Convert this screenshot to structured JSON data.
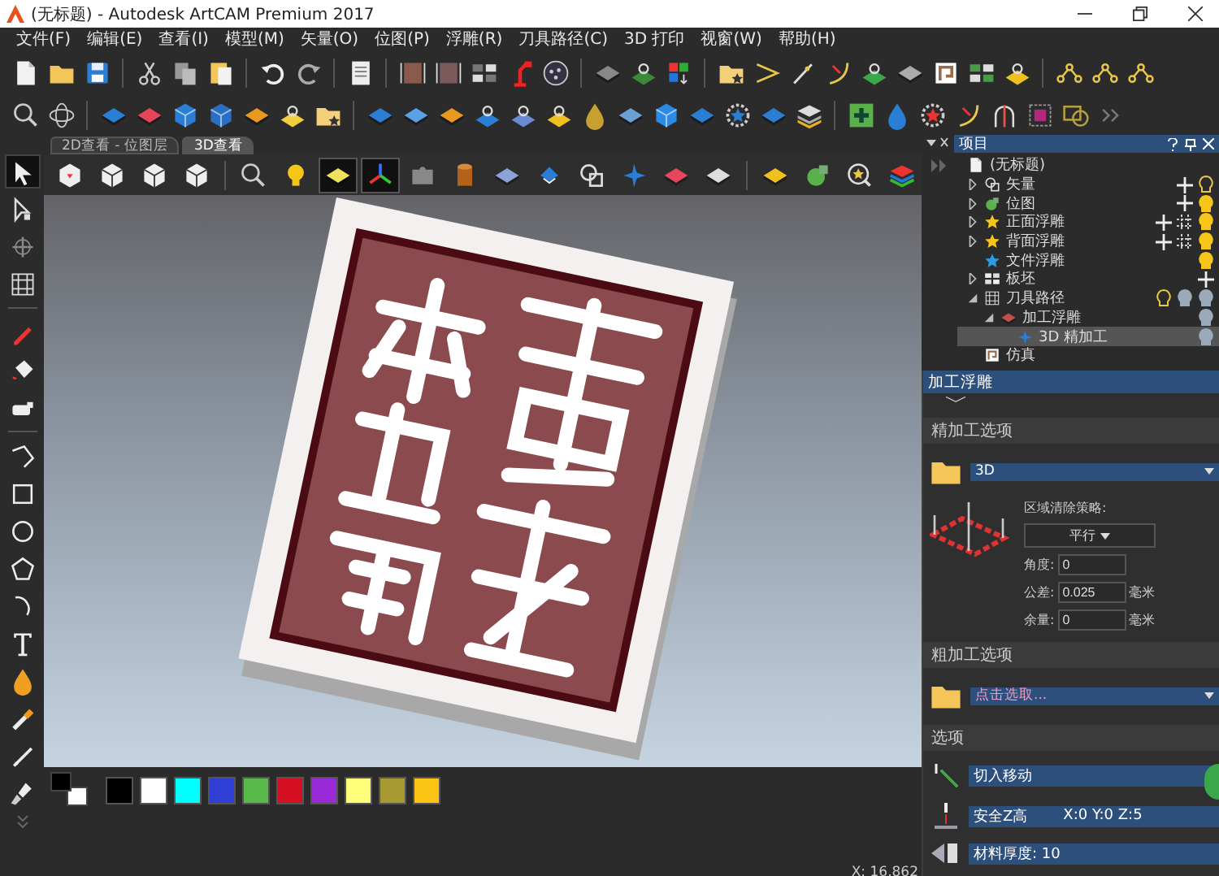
{
  "window": {
    "title": "(无标题) - Autodesk ArtCAM Premium 2017"
  },
  "menu": [
    "文件(F)",
    "编辑(E)",
    "查看(I)",
    "模型(M)",
    "矢量(O)",
    "位图(P)",
    "浮雕(R)",
    "刀具路径(C)",
    "3D 打印",
    "视窗(W)",
    "帮助(H)"
  ],
  "view_tabs": [
    {
      "label": "2D查看 - 位图层",
      "selected": false
    },
    {
      "label": "3D查看",
      "selected": true
    }
  ],
  "view_toolbar": [
    {
      "pressed": false
    },
    {
      "pressed": false
    },
    {
      "pressed": false
    },
    {
      "pressed": false
    },
    {
      "pressed": false
    },
    {
      "pressed": false
    },
    {
      "pressed": true
    },
    {
      "pressed": true
    },
    {
      "pressed": false
    },
    {
      "pressed": false
    },
    {
      "pressed": false
    },
    {
      "pressed": false
    },
    {
      "pressed": false
    },
    {
      "pressed": false
    },
    {
      "pressed": false
    },
    {
      "pressed": false
    },
    {
      "pressed": false
    },
    {
      "pressed": false
    },
    {
      "pressed": false
    },
    {
      "pressed": false
    }
  ],
  "project_panel": {
    "title": "项目",
    "root": "(无标题)",
    "items": [
      {
        "label": "矢量",
        "kind": "vector",
        "expanded": false,
        "selected": false
      },
      {
        "label": "位图",
        "kind": "bitmap",
        "expanded": false,
        "selected": false
      },
      {
        "label": "正面浮雕",
        "kind": "relief",
        "expanded": false,
        "selected": false
      },
      {
        "label": "背面浮雕",
        "kind": "relief",
        "expanded": false,
        "selected": false
      },
      {
        "label": "文件浮雕",
        "kind": "file_relief",
        "selected": false
      },
      {
        "label": "板坯",
        "kind": "block",
        "expanded": false,
        "selected": false
      },
      {
        "label": "刀具路径",
        "kind": "toolpaths",
        "expanded": true,
        "selected": false,
        "children": [
          {
            "label": "加工浮雕",
            "kind": "machine",
            "expanded": true,
            "selected": false,
            "children": [
              {
                "label": "3D 精加工",
                "kind": "finish",
                "selected": true
              }
            ]
          }
        ]
      },
      {
        "label": "仿真",
        "kind": "simulation",
        "selected": false
      }
    ]
  },
  "machining_panel": {
    "title": "加工浮雕",
    "finish": {
      "heading": "精加工选项",
      "tool": "3D",
      "strategy_label": "区域清除策略:",
      "strategy": "平行",
      "fields": [
        {
          "label": "角度:",
          "value": "0"
        },
        {
          "label": "公差:",
          "value": "0.025",
          "unit": "毫米"
        },
        {
          "label": "余量:",
          "value": "0",
          "unit": "毫米"
        }
      ]
    },
    "rough": {
      "heading": "粗加工选项",
      "tool_placeholder": "点击选取..."
    },
    "options": {
      "heading": "选项",
      "rows": [
        {
          "kind": "lead_in",
          "label": "切入移动"
        },
        {
          "kind": "safe_z",
          "label": "安全Z高",
          "value": "X:0 Y:0 Z:5"
        },
        {
          "kind": "thickness",
          "label": "材料厚度: 10"
        }
      ]
    }
  },
  "palette": {
    "current": [
      {
        "color": "#000000"
      },
      {
        "color": "#ffffff"
      }
    ],
    "colors": [
      {
        "color": "#000000"
      },
      {
        "color": "#ffffff"
      },
      {
        "color": "#00ffff"
      },
      {
        "color": "#2f3fd6"
      },
      {
        "color": "#58b84a"
      },
      {
        "color": "#d40f22"
      },
      {
        "color": "#9a2ad8"
      },
      {
        "color": "#ffff7a"
      },
      {
        "color": "#a89a32"
      },
      {
        "color": "#fcc414"
      }
    ]
  },
  "status_bar": {
    "reading": "X: 16.862"
  }
}
